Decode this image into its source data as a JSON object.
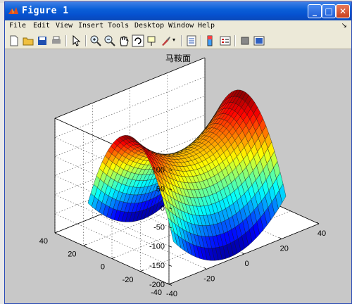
{
  "window": {
    "title": "Figure 1"
  },
  "menu": [
    "File",
    "Edit",
    "View",
    "Insert",
    "Tools",
    "Desktop",
    "Window",
    "Help"
  ],
  "toolbar": [
    "new-figure-icon",
    "open-file-icon",
    "save-icon",
    "print-icon",
    "edit-plot-icon",
    "zoom-in-icon",
    "zoom-out-icon",
    "pan-icon",
    "rotate-3d-icon",
    "data-cursor-icon",
    "brush-icon",
    "link-plot-icon",
    "colorbar-icon",
    "legend-icon",
    "hide-plot-tools-icon",
    "show-plot-tools-icon"
  ],
  "colors": {
    "titlebar": "#0a5fd8",
    "axes_bg": "#ffffff",
    "figure_bg": "#c8c8c8"
  },
  "chart_data": {
    "type": "surface",
    "title": "马鞍面",
    "function": "z = x^2/9 - y^2/4 (saddle surface)",
    "colormap": "jet",
    "zlim": [
      -200,
      100
    ],
    "xlim": [
      -40,
      40
    ],
    "ylim": [
      -40,
      40
    ],
    "z_ticks": [
      "100",
      "50",
      "0",
      "-50",
      "-100",
      "-150",
      "-200"
    ],
    "x_ticks": [
      "-40",
      "-20",
      "0",
      "20",
      "40"
    ],
    "y_ticks": [
      "40",
      "20",
      "0",
      "-20",
      "-40"
    ],
    "grid": true,
    "box": true
  }
}
